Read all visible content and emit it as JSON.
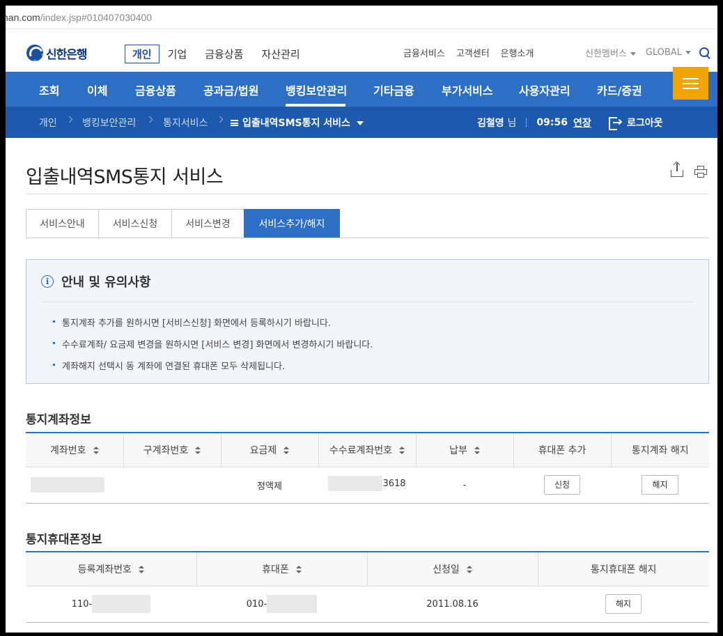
{
  "browser": {
    "url_prefix": "han.com",
    "url_path": "/index.jsp#010407030400"
  },
  "brand": {
    "name": "신한은행"
  },
  "segments": [
    "개인",
    "기업",
    "금융상품",
    "자산관리"
  ],
  "util_links": [
    "금융서비스",
    "고객센터",
    "은행소개"
  ],
  "right_links": [
    "신한멤버스",
    "GLOBAL"
  ],
  "main_menu": [
    "조회",
    "이체",
    "금융상품",
    "공과금/법원",
    "뱅킹보안관리",
    "기타금융",
    "부가서비스",
    "사용자관리",
    "카드/증권"
  ],
  "main_menu_active": "뱅킹보안관리",
  "breadcrumb": [
    "개인",
    "뱅킹보안관리",
    "통지서비스"
  ],
  "breadcrumb_current": "입출내역SMS통지 서비스",
  "user": {
    "name": "김철영",
    "suffix": "님",
    "time": "09:56",
    "extend": "연장",
    "logout": "로그아웃"
  },
  "page_title": "입출내역SMS통지 서비스",
  "tabs": [
    "서비스안내",
    "서비스신청",
    "서비스변경",
    "서비스추가/해지"
  ],
  "tab_active": "서비스추가/해지",
  "notice": {
    "title": "안내 및 유의사항",
    "items": [
      "통지계좌 추가를 원하시면 [서비스신청] 화면에서 등록하시기 바랍니다.",
      "수수료계좌/ 요금제 변경을 원하시면 [서비스 변경] 화면에서 변경하시기 바랍니다.",
      "계좌해지 선택시 동 계좌에 연결된 휴대폰 모두 삭제됩니다."
    ]
  },
  "account_section": {
    "title": "통지계좌정보",
    "headers": [
      "계좌번호",
      "구계좌번호",
      "요금제",
      "수수료계좌번호",
      "납부",
      "휴대폰 추가",
      "통지계좌 해지"
    ],
    "row": {
      "account": "",
      "old_account": "",
      "plan": "정액제",
      "fee_account_suffix": "3618",
      "payment": "-",
      "add_phone_btn": "신청",
      "cancel_btn": "해지"
    }
  },
  "phone_section": {
    "title": "통지휴대폰정보",
    "headers": [
      "등록계좌번호",
      "휴대폰",
      "신청일",
      "통지휴대폰 해지"
    ],
    "row": {
      "account_prefix": "110-",
      "phone_prefix": "010-",
      "date": "2011.08.16",
      "cancel_btn": "해지"
    }
  },
  "colors": {
    "primary": "#2d6fc4",
    "breadcrumb_bg": "#1d5aae",
    "hamburger": "#f0a500"
  }
}
